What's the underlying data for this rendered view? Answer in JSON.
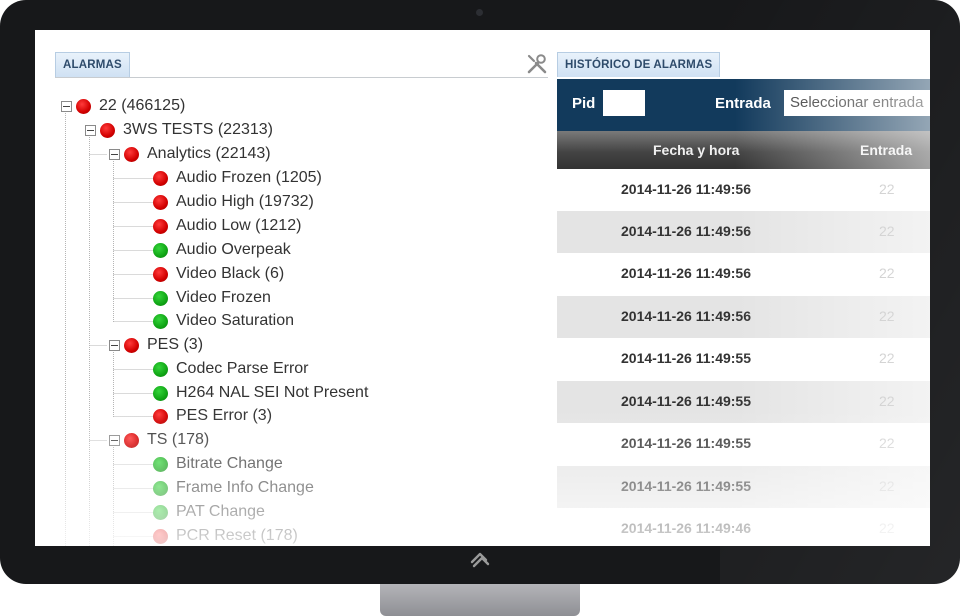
{
  "alarms_panel": {
    "tab_label": "ALARMAS",
    "tree": [
      {
        "label": "22 (466125)",
        "status": "red"
      },
      {
        "label": "3WS TESTS (22313)",
        "status": "red"
      },
      {
        "label": "Analytics (22143)",
        "status": "red"
      },
      {
        "label": "Audio Frozen (1205)",
        "status": "red"
      },
      {
        "label": "Audio High (19732)",
        "status": "red"
      },
      {
        "label": "Audio Low (1212)",
        "status": "red"
      },
      {
        "label": "Audio Overpeak",
        "status": "green"
      },
      {
        "label": "Video Black (6)",
        "status": "red"
      },
      {
        "label": "Video Frozen",
        "status": "green"
      },
      {
        "label": "Video Saturation",
        "status": "green"
      },
      {
        "label": "PES (3)",
        "status": "red"
      },
      {
        "label": "Codec Parse Error",
        "status": "green"
      },
      {
        "label": "H264 NAL SEI Not Present",
        "status": "green"
      },
      {
        "label": "PES Error (3)",
        "status": "red"
      },
      {
        "label": "TS (178)",
        "status": "red"
      },
      {
        "label": "Bitrate Change",
        "status": "green"
      },
      {
        "label": "Frame Info Change",
        "status": "green"
      },
      {
        "label": "PAT Change",
        "status": "green"
      },
      {
        "label": "PCR Reset (178)",
        "status": "red"
      }
    ],
    "colors": {
      "red": "#d20000",
      "green": "#10a515"
    }
  },
  "history_panel": {
    "tab_label": "HISTÓRICO DE ALARMAS",
    "filters": {
      "pid_label": "Pid",
      "pid_value": "",
      "entrada_label": "Entrada",
      "entrada_value": "Seleccionar entrada"
    },
    "columns": [
      "Fecha y hora",
      "Entrada"
    ],
    "rows": [
      {
        "fecha": "2014-11-26 11:49:56",
        "entrada": "22"
      },
      {
        "fecha": "2014-11-26 11:49:56",
        "entrada": "22"
      },
      {
        "fecha": "2014-11-26 11:49:56",
        "entrada": "22"
      },
      {
        "fecha": "2014-11-26 11:49:56",
        "entrada": "22"
      },
      {
        "fecha": "2014-11-26 11:49:55",
        "entrada": "22"
      },
      {
        "fecha": "2014-11-26 11:49:55",
        "entrada": "22"
      },
      {
        "fecha": "2014-11-26 11:49:55",
        "entrada": "22"
      },
      {
        "fecha": "2014-11-26 11:49:55",
        "entrada": "22"
      },
      {
        "fecha": "2014-11-26 11:49:46",
        "entrada": "22"
      }
    ],
    "header_color": "#123a5c"
  },
  "icons": {
    "tools": "tools-icon",
    "brand_logo": "logo-icon"
  }
}
